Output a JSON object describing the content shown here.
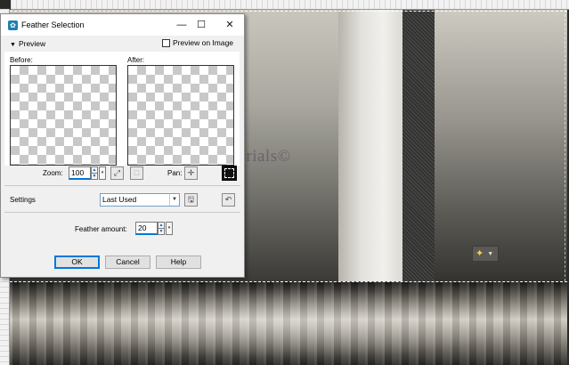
{
  "dialog": {
    "title": "Feather Selection",
    "preview_section": "Preview",
    "preview_on_image_label": "Preview on Image",
    "preview_on_image_checked": false,
    "before_label": "Before:",
    "after_label": "After:",
    "zoom_label": "Zoom:",
    "zoom_value": "100",
    "pan_label": "Pan:",
    "settings_label": "Settings",
    "settings_value": "Last Used",
    "feather_label": "Feather amount:",
    "feather_value": "20",
    "ok_label": "OK",
    "cancel_label": "Cancel",
    "help_label": "Help",
    "minimize_glyph": "—",
    "maximize_glyph": "☐",
    "close_glyph": "✕"
  },
  "canvas": {
    "watermark": "MaryTutorials©"
  },
  "icons": {
    "app": "paintshop-icon",
    "zoom_fit": "zoom-fit-icon",
    "zoom_actual": "zoom-actual-icon",
    "pan": "pan-icon",
    "save_preset": "save-preset-icon",
    "reset": "reset-icon",
    "magic_wand": "magic-wand-icon"
  },
  "colors": {
    "accent": "#0078d7",
    "app_icon": "#1f7fb0"
  }
}
